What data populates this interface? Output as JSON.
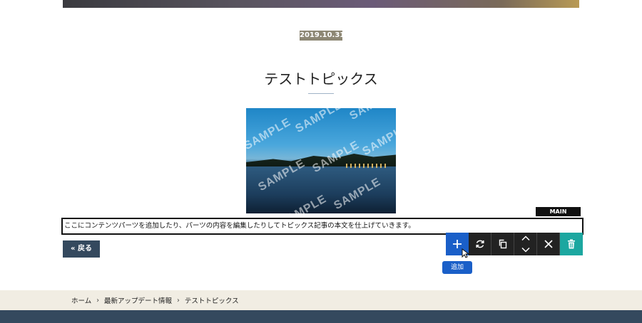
{
  "post": {
    "date": "2019.10.31",
    "title": "テストトピックス",
    "image_watermark": "SAMPLE",
    "body_text": "ここにコンテンツパーツを追加したり、パーツの内容を編集したりしてトピックス記事の本文を仕上げていきます。"
  },
  "editor": {
    "main_tag": "MAIN 1140×25",
    "toolbar": {
      "add_icon": "plus-icon",
      "replace_icon": "refresh-icon",
      "copy_icon": "copy-icon",
      "up_icon": "chevron-up-icon",
      "down_icon": "chevron-down-icon",
      "close_icon": "close-icon",
      "delete_icon": "trash-icon"
    },
    "tooltip": "追加"
  },
  "nav": {
    "back_label": "« 戻る"
  },
  "breadcrumb": {
    "items": [
      "ホーム",
      "最新アップデート情報",
      "テストトピックス"
    ],
    "separator": "›"
  },
  "colors": {
    "date_badge": "#8d8774",
    "add_button": "#1a5fc8",
    "delete_button": "#1ca7a0",
    "toolbar_dark": "#222222",
    "back_button": "#34495e",
    "breadcrumb_bg": "#f1ede3",
    "footer": "#34495e"
  }
}
